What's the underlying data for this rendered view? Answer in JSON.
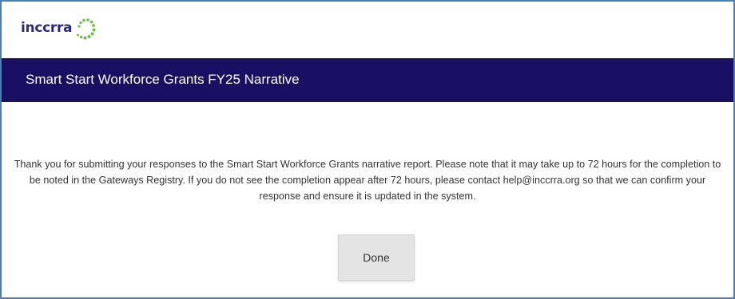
{
  "logo": {
    "text": "inccrra",
    "brand_color": "#2b2a7e",
    "accent_color": "#6cc24a"
  },
  "header": {
    "title": "Smart Start Workforce Grants FY25 Narrative",
    "background": "#1a1063"
  },
  "main": {
    "message": "Thank you for submitting your responses to the Smart Start Workforce Grants narrative report. Please note that it may take up to 72 hours for the completion to be noted in the Gateways Registry. If you do not see the completion appear after 72 hours, please contact help@inccrra.org so that we can confirm your response and ensure it is updated in the system.",
    "done_label": "Done"
  },
  "frame_border_color": "#4a7fb5"
}
